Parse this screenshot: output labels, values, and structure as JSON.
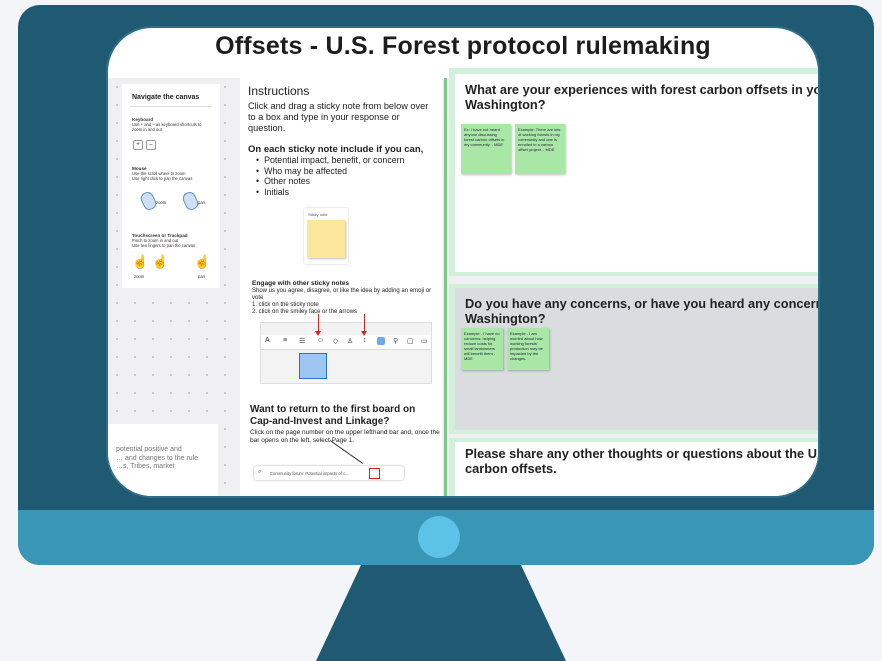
{
  "board": {
    "title": "Offsets - U.S. Forest protocol rulemaking"
  },
  "nav_panel": {
    "title": "Navigate the canvas",
    "keyboard_heading": "Keyboard",
    "keyboard_text": "Use + and – as keyboard shortcuts to zoom in and out",
    "plus_key": "+",
    "minus_key": "–",
    "mouse_heading": "Mouse",
    "mouse_text": "Use the scroll wheel to zoom\nUse right click to pan the canvas",
    "mouse_zoom_label": "zoom",
    "mouse_pan_label": "pan",
    "touch_heading": "Touchscreen or Trackpad",
    "touch_text": "Pinch to zoom in and out\nUse two fingers to pan the canvas",
    "touch_zoom_label": "zoom",
    "touch_pan_label": "pan"
  },
  "partial_card": {
    "text": "potential positive and\n… and changes to the rule\n…s, Tribes, market"
  },
  "instructions": {
    "heading": "Instructions",
    "intro": "Click and drag a sticky note from below over to a box and type in your response or question.",
    "subheading": "On each sticky note include if you can,",
    "bullets": [
      "Potential impact, benefit, or concern",
      "Who may be affected",
      "Other notes",
      "Initials"
    ],
    "sticky_label": "Sticky note",
    "engage_heading": "Engage with other sticky notes",
    "engage_text": "Show us you agree, disagree, or like the idea by adding an emoji or vote\n  1. click on the sticky note\n  2. click on the smiley face or the arrows",
    "return_heading": "Want to return to the first board on Cap-and-Invest and Linkage?",
    "return_text": "Click on the page number on the upper lefthand bar and, once the bar opens on the left, select Page 1.",
    "bar_text": "Community forum: Potential impacts of c..."
  },
  "questions": [
    {
      "text": "What are your experiences with forest carbon offsets in your\nWashington?",
      "notes": [
        "Ex: I have not heard anyone discussing forest carbon offsets in my community. - MDE",
        "Example: There are lots of working forests in my community and one is enrolled in a carbon offset project. - MDE"
      ]
    },
    {
      "text": "Do you have any concerns, or have you heard any concerns,\nWashington?",
      "notes": [
        "Example - I have no concerns; helping reduce costs for small landowners will benefit them - MDE",
        "Example - I am worried about how working forests' production may be impacted by the changes."
      ]
    },
    {
      "text": "Please share any other thoughts or questions about the U\ncarbon offsets.",
      "notes": []
    }
  ],
  "colors": {
    "monitor_frame": "#1f5a72",
    "monitor_base": "#3a96b7",
    "power_button": "#5cc3e6",
    "question_border": "#d2f1dc",
    "green_sticky": "#a9e7a7",
    "yellow_sticky": "#fbe79c"
  }
}
